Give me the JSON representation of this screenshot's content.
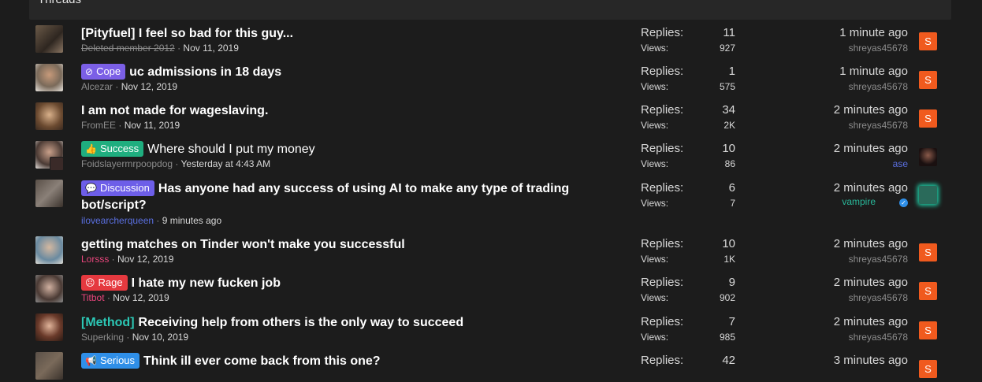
{
  "header": {
    "title": "Threads"
  },
  "threads": [
    {
      "prefix": "",
      "title": "[Pityfuel] I feel so bad for this guy...",
      "author": "Deleted member 2012",
      "date": "Nov 11, 2019",
      "replies_label": "Replies:",
      "replies": "11",
      "views_label": "Views:",
      "views": "927",
      "last_time": "1 minute ago",
      "last_user": "shreyas45678",
      "last_avatar": "S"
    },
    {
      "prefix": "Cope",
      "title": "uc admissions in 18 days",
      "author": "Alcezar",
      "date": "Nov 12, 2019",
      "replies_label": "Replies:",
      "replies": "1",
      "views_label": "Views:",
      "views": "575",
      "last_time": "1 minute ago",
      "last_user": "shreyas45678",
      "last_avatar": "S"
    },
    {
      "prefix": "",
      "title": "I am not made for wageslaving.",
      "author": "FromEE",
      "date": "Nov 11, 2019",
      "replies_label": "Replies:",
      "replies": "34",
      "views_label": "Views:",
      "views": "2K",
      "last_time": "2 minutes ago",
      "last_user": "shreyas45678",
      "last_avatar": "S"
    },
    {
      "prefix": "Success",
      "title": "Where should I put my money",
      "author": "Foidslayermrpoopdog",
      "date": "Yesterday at 4:43 AM",
      "replies_label": "Replies:",
      "replies": "10",
      "views_label": "Views:",
      "views": "86",
      "last_time": "2 minutes ago",
      "last_user": "ase",
      "last_avatar": ""
    },
    {
      "prefix": "Discussion",
      "title": "Has anyone had any success of using AI to make any type of trading bot/script?",
      "author": "ilovearcherqueen",
      "date": "9 minutes ago",
      "replies_label": "Replies:",
      "replies": "6",
      "views_label": "Views:",
      "views": "7",
      "last_time": "2 minutes ago",
      "last_user": "vampire",
      "last_avatar": ""
    },
    {
      "prefix": "",
      "title": "getting matches on Tinder won't make you successful",
      "author": "Lorsss",
      "date": "Nov 12, 2019",
      "replies_label": "Replies:",
      "replies": "10",
      "views_label": "Views:",
      "views": "1K",
      "last_time": "2 minutes ago",
      "last_user": "shreyas45678",
      "last_avatar": "S"
    },
    {
      "prefix": "Rage",
      "title": "I hate my new fucken job",
      "author": "Titbot",
      "date": "Nov 12, 2019",
      "replies_label": "Replies:",
      "replies": "9",
      "views_label": "Views:",
      "views": "902",
      "last_time": "2 minutes ago",
      "last_user": "shreyas45678",
      "last_avatar": "S"
    },
    {
      "prefix": "[Method]",
      "title": "Receiving help from others is the only way to succeed",
      "author": "Superking",
      "date": "Nov 10, 2019",
      "replies_label": "Replies:",
      "replies": "7",
      "views_label": "Views:",
      "views": "985",
      "last_time": "2 minutes ago",
      "last_user": "shreyas45678",
      "last_avatar": "S"
    },
    {
      "prefix": "Serious",
      "title": "Think ill ever come back from this one?",
      "author": "",
      "date": "",
      "replies_label": "Replies:",
      "replies": "42",
      "views_label": "",
      "views": "",
      "last_time": "3 minutes ago",
      "last_user": "",
      "last_avatar": "S"
    }
  ],
  "colors": {
    "accent_orange": "#f05a1e",
    "prefix_cope": "#7b5fe6",
    "prefix_success": "#1fae7f",
    "prefix_rage": "#e5393f",
    "prefix_serious": "#2f8fe8",
    "prefix_method": "#2cc7b5"
  }
}
